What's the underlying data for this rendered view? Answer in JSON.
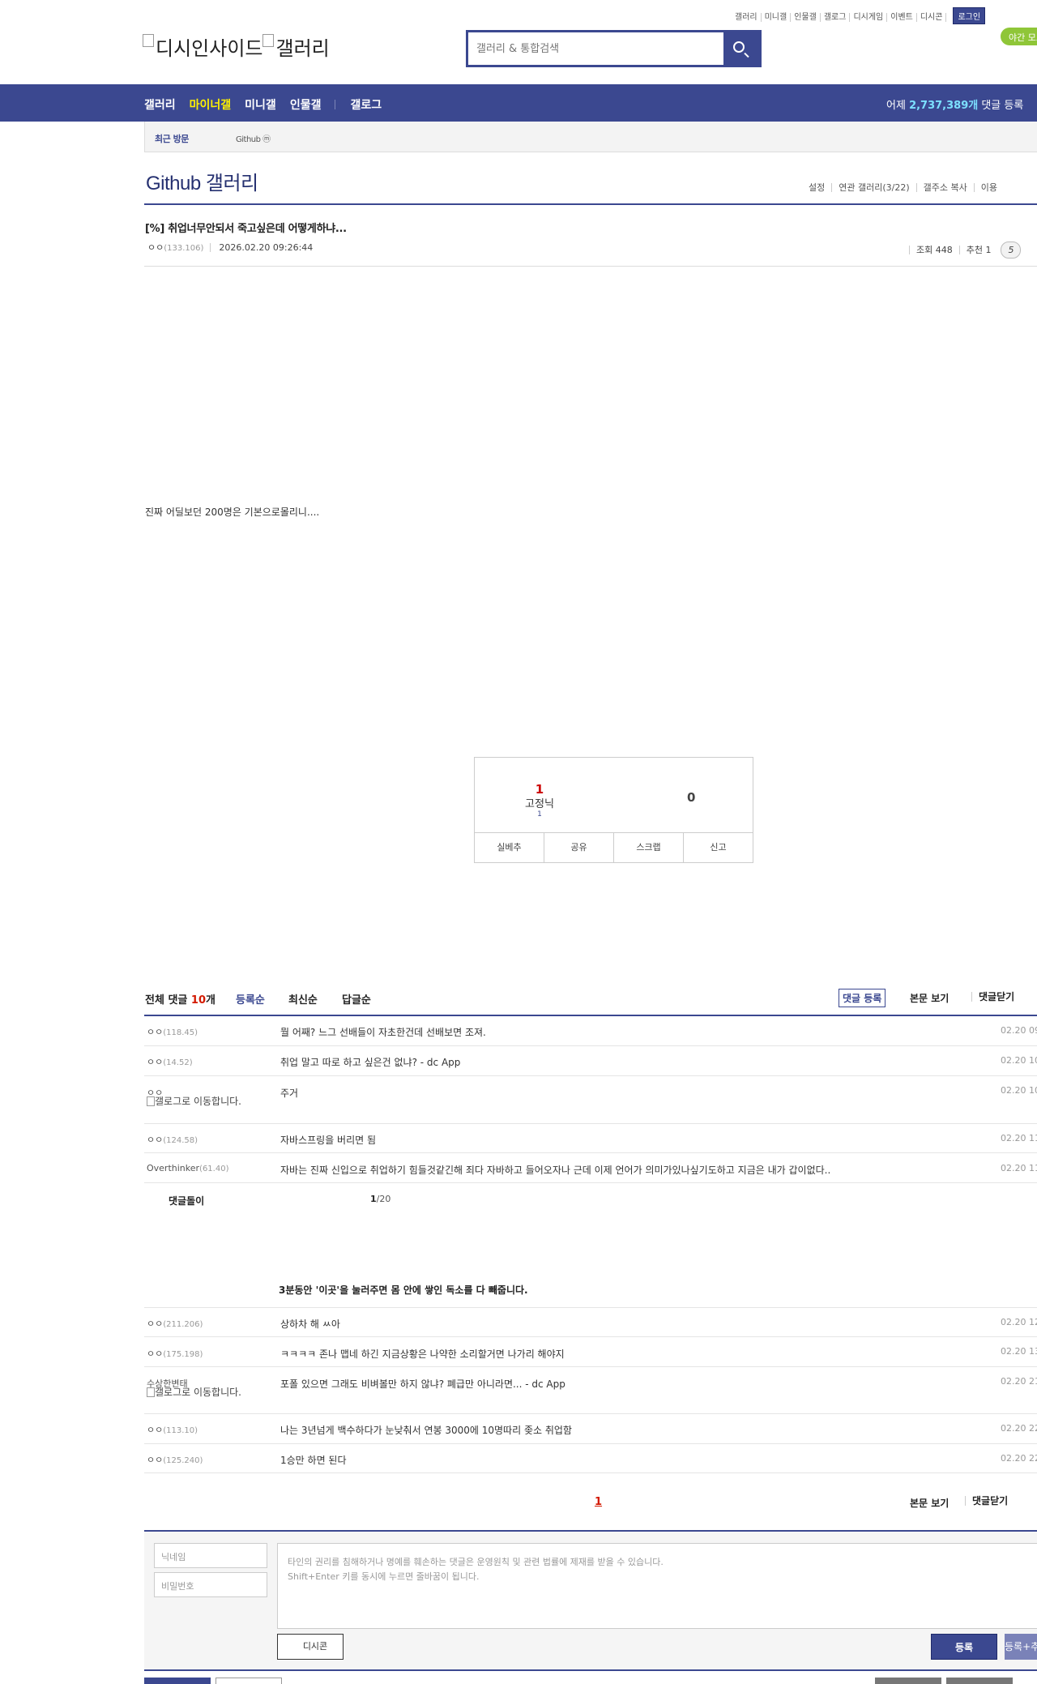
{
  "util": {
    "items": [
      "갤러리",
      "미니갤",
      "인물갤",
      "갤로그",
      "디시게임",
      "이벤트",
      "디시콘"
    ],
    "login": "로그인",
    "night": "야간 모드"
  },
  "logo": {
    "alt1": "디시인사이드",
    "alt2": "갤러리"
  },
  "search": {
    "placeholder": "갤러리 & 통합검색"
  },
  "nav": {
    "links": [
      "갤러리",
      "마이너갤",
      "미니갤",
      "인물갤",
      "갤로그"
    ],
    "stat_prefix": "어제 ",
    "stat_count": "2,737,389개",
    "stat_suffix": " 댓글 등록"
  },
  "recent": {
    "label": "최근 방문",
    "tag": "Github ⓜ"
  },
  "gallery": {
    "title": "Github 갤러리",
    "tools": [
      "설정",
      "연관 갤러리(3/22)",
      "갤주소 복사",
      "이용"
    ]
  },
  "post": {
    "title": "[%] 취업너무안되서 죽고싶은데 어떻게하냐...",
    "author": "ㅇㅇ",
    "ip": "(133.106)",
    "date": "2026.02.20 09:26:44",
    "views": "조회 448",
    "recommends": "추천 1",
    "comment_pill": "5",
    "body": "진짜 어딜보던 200명은 기본으로몰리니...."
  },
  "recommend": {
    "up_count": "1",
    "up_img_alt": "고정닉",
    "up_sub": "1",
    "down_count": "0",
    "buttons": [
      "실베추",
      "공유",
      "스크랩",
      "신고"
    ]
  },
  "comments_header": {
    "total_prefix": "전체 댓글 ",
    "total_count": "10",
    "total_suffix": "개",
    "sort": [
      "등록순",
      "최신순",
      "답글순"
    ],
    "write": "댓글 등록",
    "view_body": "본문 보기",
    "close": "댓글닫기"
  },
  "comments": [
    {
      "nick": "ㅇㅇ",
      "ip": "(118.45)",
      "text": "뭘 어째? 느그 선배들이 자초한건데 선배보면 조져.",
      "time": "02.20 09"
    },
    {
      "nick": "ㅇㅇ",
      "ip": "(14.52)",
      "text": "취업 말고 따로 하고 싶은건 없냐? - dc App",
      "time": "02.20 10"
    },
    {
      "nick": "ㅇㅇ",
      "ip": "",
      "galog": "갤로그로 이동합니다.",
      "text": "주거",
      "time": "02.20 10"
    },
    {
      "nick": "ㅇㅇ",
      "ip": "(124.58)",
      "text": "자바스프링을 버리면 됨",
      "time": "02.20 11"
    },
    {
      "nick": "Overthinker",
      "ip": "(61.40)",
      "text": "자바는 진짜 신입으로 취업하기 힘들것같긴해 죄다 자바하고 들어오자나 근데 이제 언어가 의미가있나싶기도하고 지금은 내가 갑이없다..",
      "time": "02.20 11"
    }
  ],
  "dolly": {
    "label": "댓글돌이",
    "page_current": "1",
    "page_total": "/20"
  },
  "ad_text": "3분동안 '이곳'을 눌러주면 몸 안에 쌓인 독소를 다 빼줍니다.",
  "comments2": [
    {
      "nick": "ㅇㅇ",
      "ip": "(211.206)",
      "text": "상하차 해 ㅆ아",
      "time": "02.20 12"
    },
    {
      "nick": "ㅇㅇ",
      "ip": "(175.198)",
      "text": "ㅋㅋㅋㅋ 존나 맵네 하긴 지금상황은 나약한 소리할거면 나가리 해야지",
      "time": "02.20 13"
    },
    {
      "nick": "수상한변태",
      "ip": "",
      "galog": "갤로그로 이동합니다.",
      "text": "포폴 있으면 그래도 비벼볼만 하지 않냐? 폐급만 아니라면... - dc App",
      "time": "02.20 21"
    },
    {
      "nick": "ㅇㅇ",
      "ip": "(113.10)",
      "text": "나는 3년넘게 백수하다가 눈낮춰서 연봉 3000에 10명따리 좆소 취업함",
      "time": "02.20 22"
    },
    {
      "nick": "ㅇㅇ",
      "ip": "(125.240)",
      "text": "1승만 하면 된다",
      "time": "02.20 22"
    }
  ],
  "pagination": {
    "current": "1"
  },
  "form": {
    "nick_placeholder": "닉네임",
    "pw_placeholder": "비밀번호",
    "notice1": "타인의 권리를 침해하거나 명예를 훼손하는 댓글은 운영원칙 및 관련 법률에 제재를 받을 수 있습니다.",
    "notice2": "Shift+Enter 키를 동시에 누르면 줄바꿈이 됩니다.",
    "dccon": "디시콘",
    "submit": "등록",
    "submit2": "등록+추천"
  }
}
